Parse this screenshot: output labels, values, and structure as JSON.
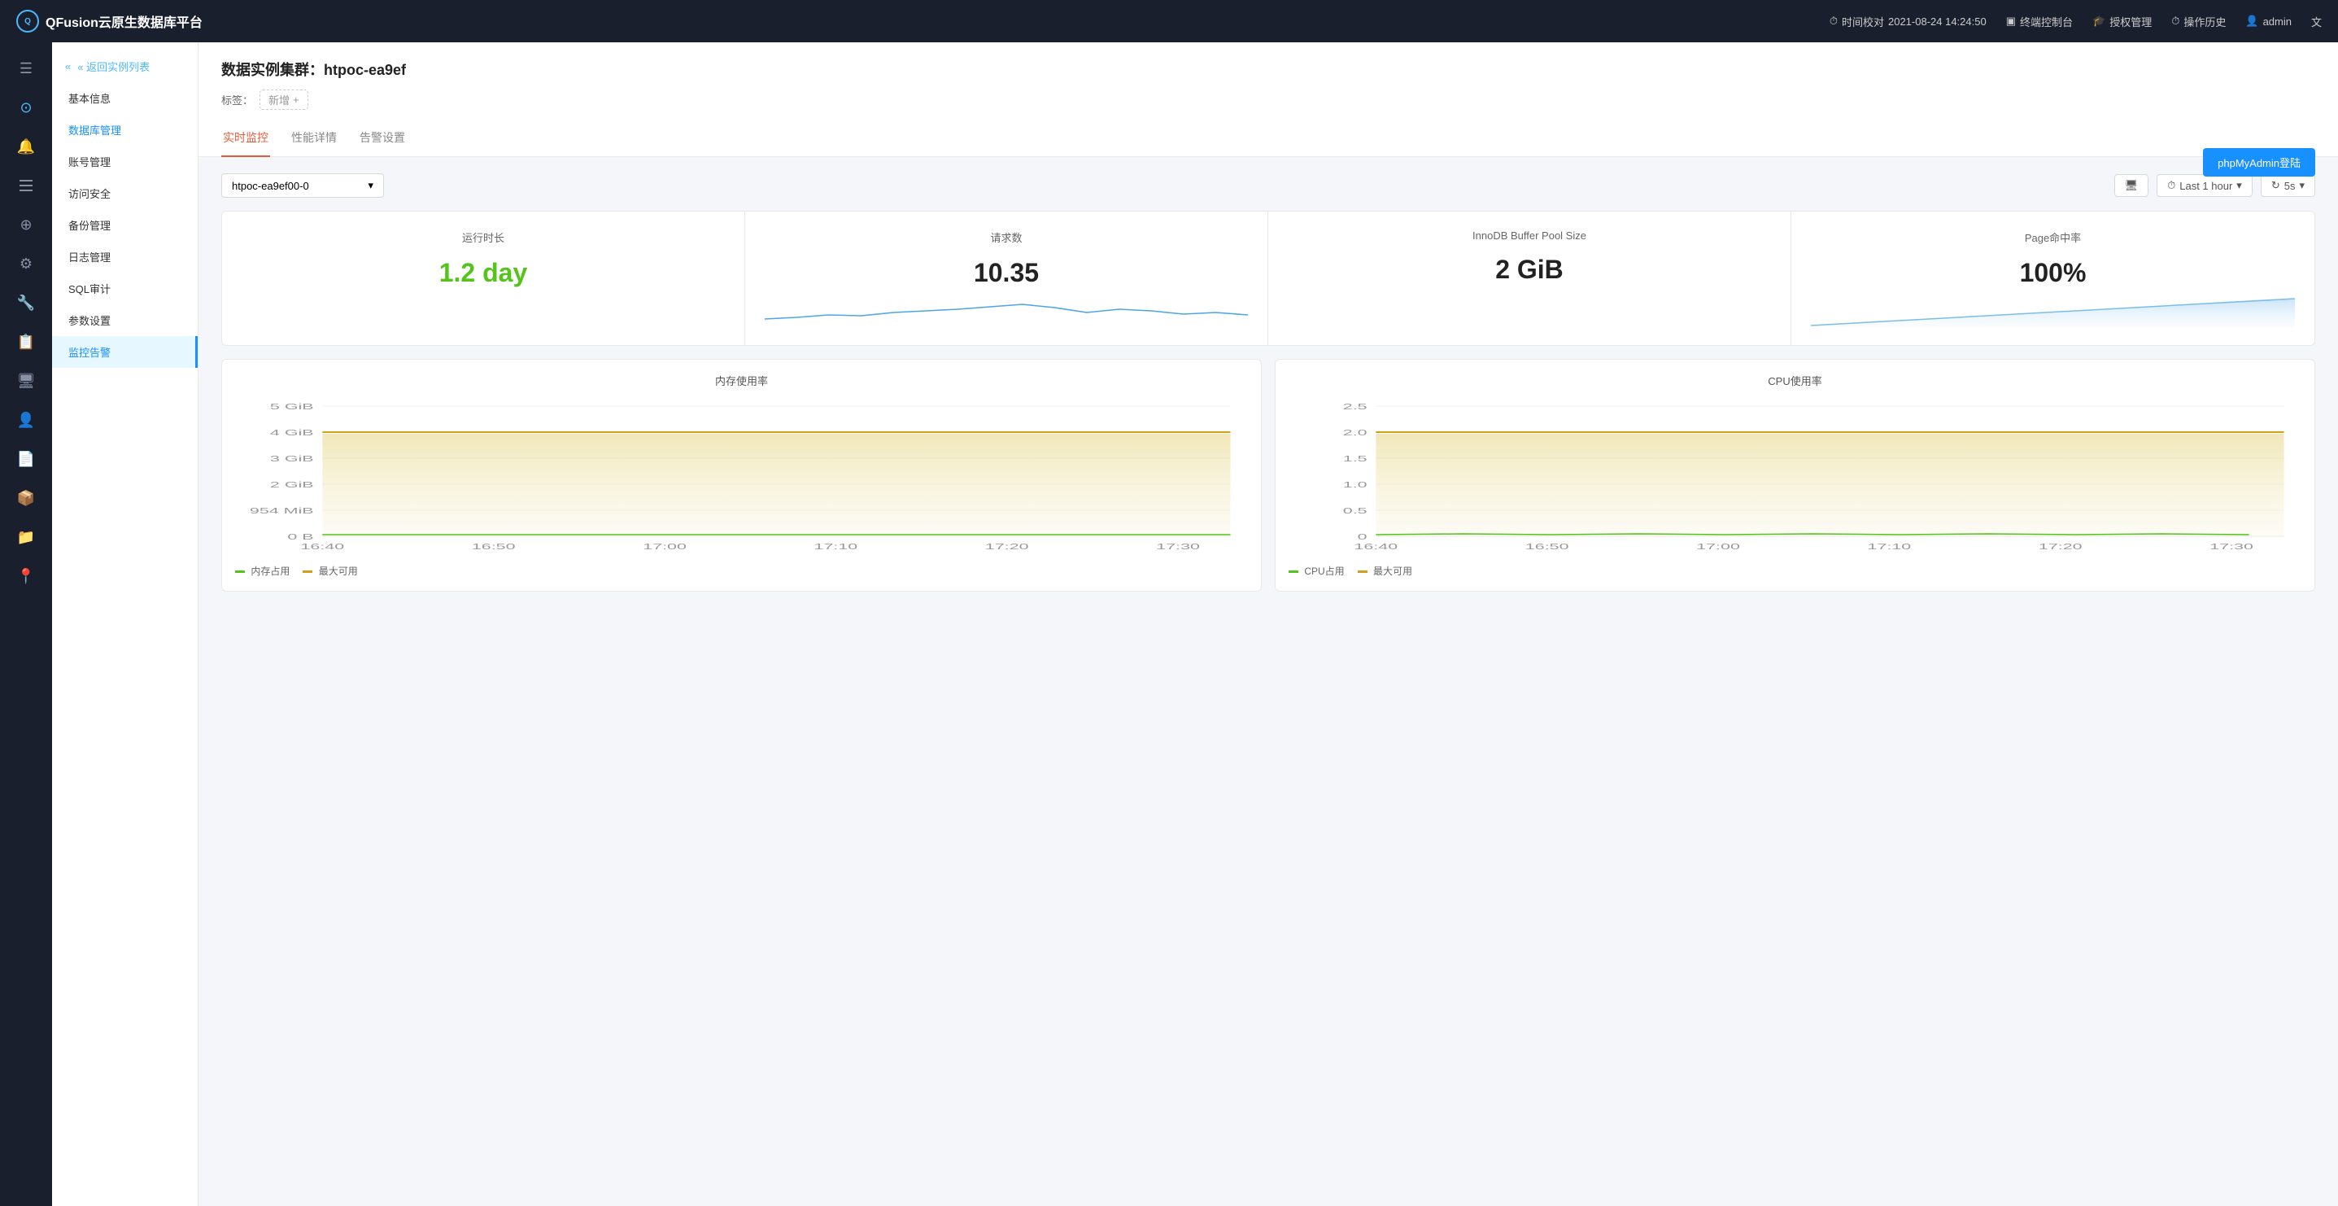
{
  "app": {
    "name": "QFusion云原生数据库平台"
  },
  "topnav": {
    "time_icon": "⏱",
    "time_label": "时间校对",
    "time_value": "2021-08-24 14:24:50",
    "terminal_icon": "▣",
    "terminal_label": "终端控制台",
    "auth_icon": "🎓",
    "auth_label": "授权管理",
    "history_icon": "⏱",
    "history_label": "操作历史",
    "user_icon": "👤",
    "user_label": "admin",
    "lang_icon": "文"
  },
  "icon_sidebar": {
    "items": [
      {
        "icon": "☰",
        "name": "menu"
      },
      {
        "icon": "⊙",
        "name": "dashboard"
      },
      {
        "icon": "🔔",
        "name": "alerts"
      },
      {
        "icon": "≡",
        "name": "layers"
      },
      {
        "icon": "⊕",
        "name": "circle"
      },
      {
        "icon": "⚙",
        "name": "settings"
      },
      {
        "icon": "🔧",
        "name": "tools"
      },
      {
        "icon": "📋",
        "name": "list"
      },
      {
        "icon": "🖥",
        "name": "monitor"
      },
      {
        "icon": "👤",
        "name": "user"
      },
      {
        "icon": "📄",
        "name": "docs"
      },
      {
        "icon": "📦",
        "name": "package"
      },
      {
        "icon": "📁",
        "name": "folder"
      },
      {
        "icon": "📍",
        "name": "location"
      }
    ]
  },
  "sidebar": {
    "back_label": "« 返回实例列表",
    "items": [
      {
        "label": "基本信息",
        "key": "basic"
      },
      {
        "label": "数据库管理",
        "key": "db",
        "active": false
      },
      {
        "label": "账号管理",
        "key": "account"
      },
      {
        "label": "访问安全",
        "key": "security"
      },
      {
        "label": "备份管理",
        "key": "backup"
      },
      {
        "label": "日志管理",
        "key": "log"
      },
      {
        "label": "SQL审计",
        "key": "sql"
      },
      {
        "label": "参数设置",
        "key": "params"
      },
      {
        "label": "监控告警",
        "key": "monitor",
        "active": true
      }
    ]
  },
  "header": {
    "cluster_label": "数据实例集群：",
    "cluster_name": "htpoc-ea9ef",
    "tag_label": "标签：",
    "tag_add": "新增",
    "phpmyadmin_btn": "phpMyAdmin登陆"
  },
  "tabs": [
    {
      "label": "实时监控",
      "active": true
    },
    {
      "label": "性能详情",
      "active": false
    },
    {
      "label": "告警设置",
      "active": false
    }
  ],
  "toolbar": {
    "node_select": "htpoc-ea9ef00-0",
    "node_arrow": "▾",
    "screen_icon": "🖥",
    "time_range": "Last 1 hour",
    "refresh_interval": "5s"
  },
  "stats": [
    {
      "title": "运行时长",
      "value": "1.2 day",
      "value_color": "green",
      "has_chart": false
    },
    {
      "title": "请求数",
      "value": "10.35",
      "value_color": "dark",
      "has_chart": true
    },
    {
      "title": "InnoDB Buffer Pool Size",
      "value": "2 GiB",
      "value_color": "dark",
      "has_chart": false
    },
    {
      "title": "Page命中率",
      "value": "100%",
      "value_color": "dark",
      "has_chart": true,
      "chart_type": "area_rising"
    }
  ],
  "charts": [
    {
      "title": "内存使用率",
      "y_labels": [
        "5 GiB",
        "4 GiB",
        "3 GiB",
        "2 GiB",
        "954 MiB",
        "0 B"
      ],
      "x_labels": [
        "16:40",
        "16:50",
        "17:00",
        "17:10",
        "17:20",
        "17:30"
      ],
      "legend": [
        "内存占用",
        "最大可用"
      ]
    },
    {
      "title": "CPU使用率",
      "y_labels": [
        "2.5",
        "2.0",
        "1.5",
        "1.0",
        "0.5",
        "0"
      ],
      "x_labels": [
        "16:40",
        "16:50",
        "17:00",
        "17:10",
        "17:20",
        "17:30"
      ],
      "legend": [
        "CPU占用",
        "最大可用"
      ]
    }
  ]
}
